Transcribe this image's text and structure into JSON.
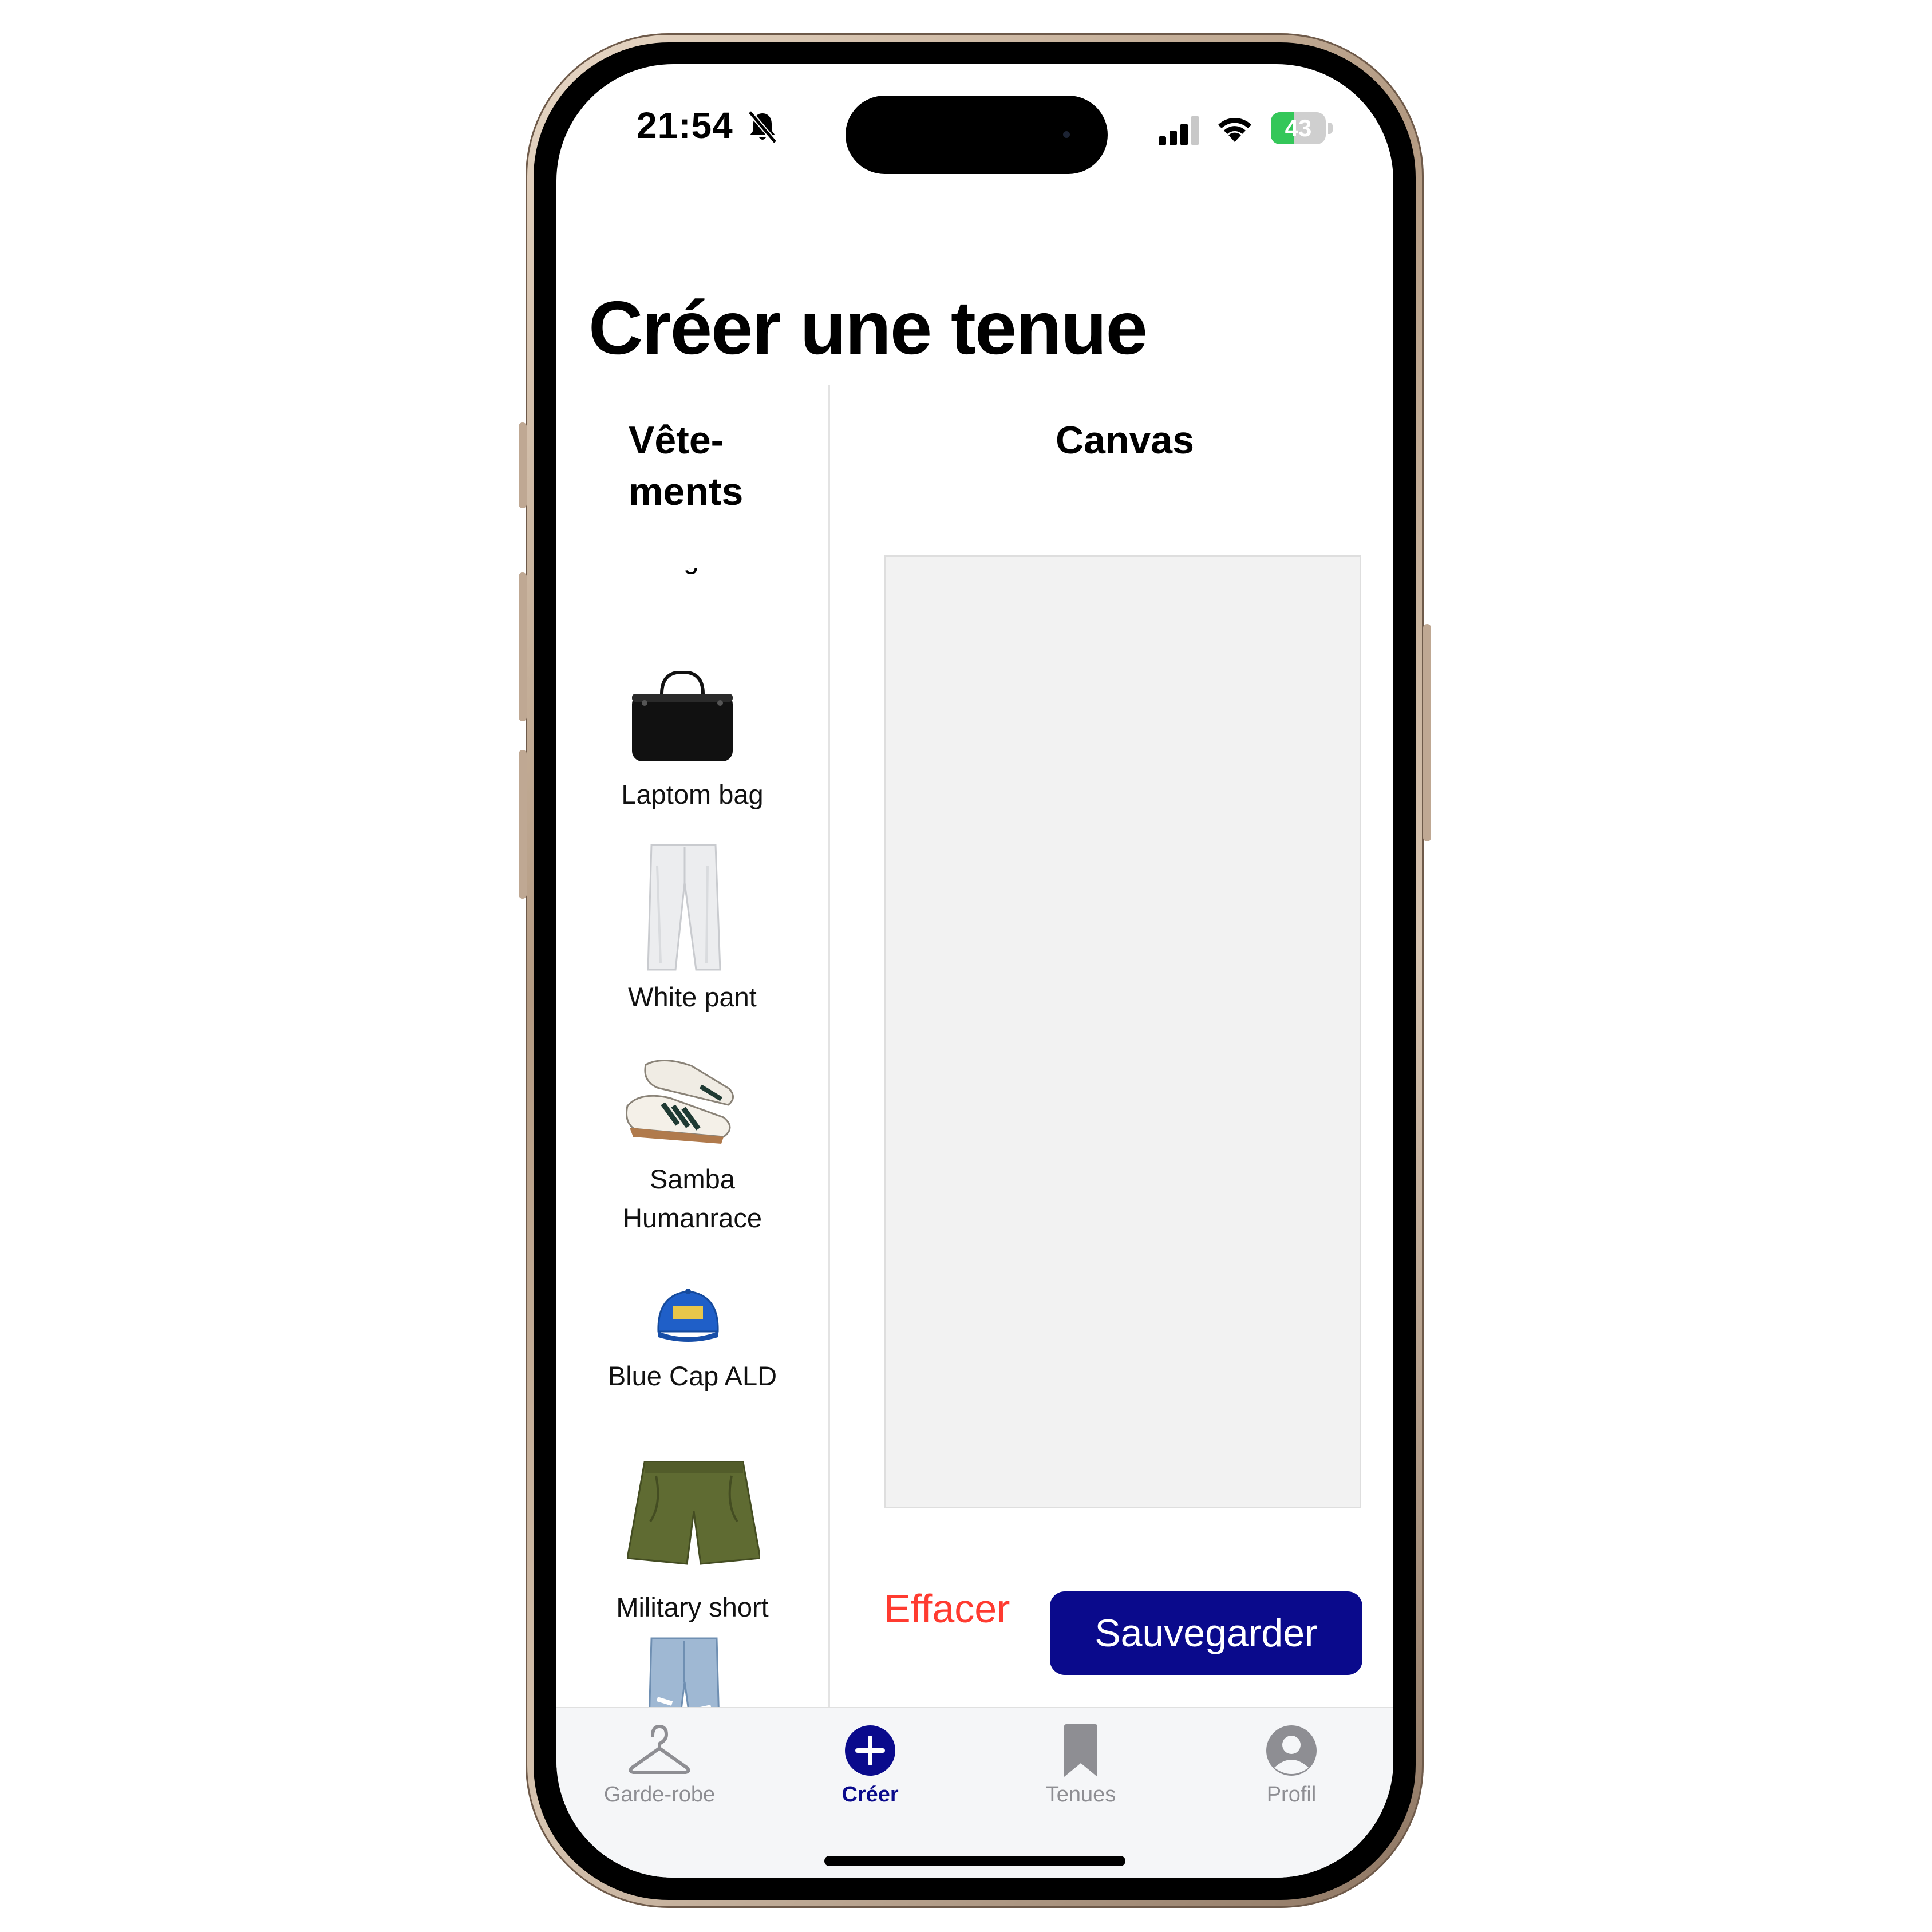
{
  "status_bar": {
    "time": "21:54",
    "battery_level": "43",
    "battery_fraction": 0.43,
    "icons": [
      "bell-slash-icon",
      "cellular-signal-icon",
      "wifi-icon",
      "battery-charging-icon"
    ]
  },
  "page": {
    "title": "Créer une tenue"
  },
  "sidebar": {
    "heading_line1": "Vête-",
    "heading_line2": "ments",
    "partially_hidden_label": "g",
    "items": [
      {
        "label": "Laptom bag",
        "icon": "laptop-bag-image"
      },
      {
        "label": "White pant",
        "icon": "white-pant-image"
      },
      {
        "label_line1": "Samba",
        "label_line2": "Humanrace",
        "icon": "sneakers-image"
      },
      {
        "label": "Blue Cap ALD",
        "icon": "blue-cap-image"
      },
      {
        "label": "Military short",
        "icon": "military-short-image"
      },
      {
        "label": "",
        "icon": "jeans-image"
      }
    ]
  },
  "canvas": {
    "heading": "Canvas"
  },
  "actions": {
    "clear_label": "Effacer",
    "save_label": "Sauvegarder"
  },
  "tab_bar": {
    "tabs": [
      {
        "label": "Garde-robe",
        "icon": "hanger-icon",
        "active": false
      },
      {
        "label": "Créer",
        "icon": "plus-circle-icon",
        "active": true
      },
      {
        "label": "Tenues",
        "icon": "bookmark-icon",
        "active": false
      },
      {
        "label": "Profil",
        "icon": "person-circle-icon",
        "active": false
      }
    ]
  },
  "colors": {
    "accent": "#0a0a8c",
    "destructive": "#ff3b30",
    "inactive_tab": "#8e8e93",
    "canvas_bg": "#f2f2f2",
    "battery_green": "#34c759"
  }
}
